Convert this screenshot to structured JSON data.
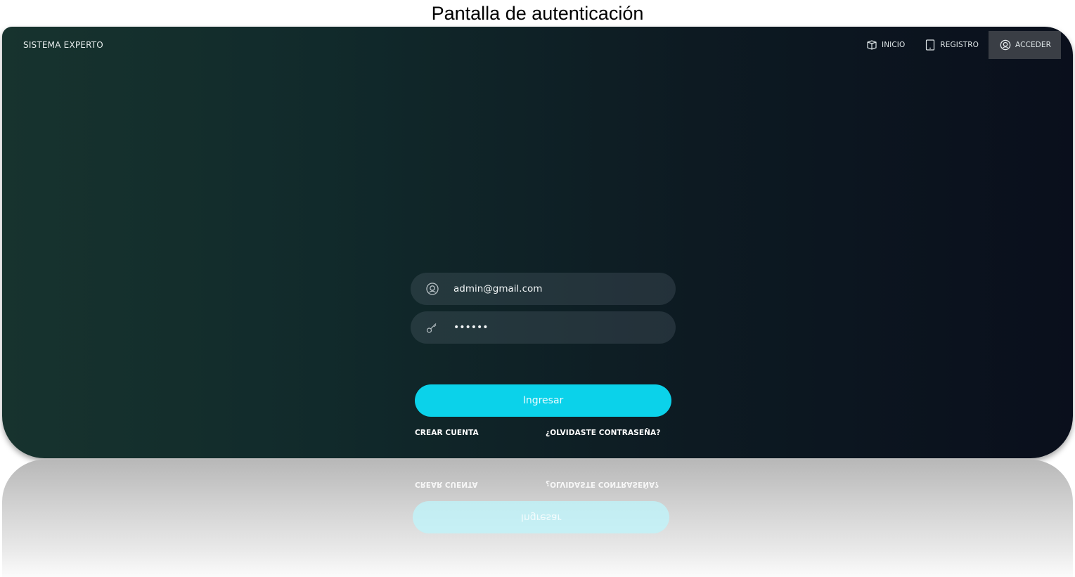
{
  "caption": "Pantalla de autenticación",
  "header": {
    "brand": "SISTEMA EXPERTO",
    "nav": [
      {
        "label": "INICIO",
        "icon": "cube-icon",
        "active": false
      },
      {
        "label": "REGISTRO",
        "icon": "tablet-icon",
        "active": false
      },
      {
        "label": "ACCEDER",
        "icon": "user-circle-icon",
        "active": true
      }
    ]
  },
  "login": {
    "email_value": "admin@gmail.com",
    "password_value": "••••••",
    "submit_label": "Ingresar",
    "create_account_label": "CREAR CUENTA",
    "forgot_password_label": "¿OLVIDASTE CONTRASEÑA?"
  },
  "colors": {
    "accent": "#0bd2ea",
    "background_left": "#17332e",
    "background_right": "#0a0f1c",
    "active_nav": "#3a3e45"
  }
}
